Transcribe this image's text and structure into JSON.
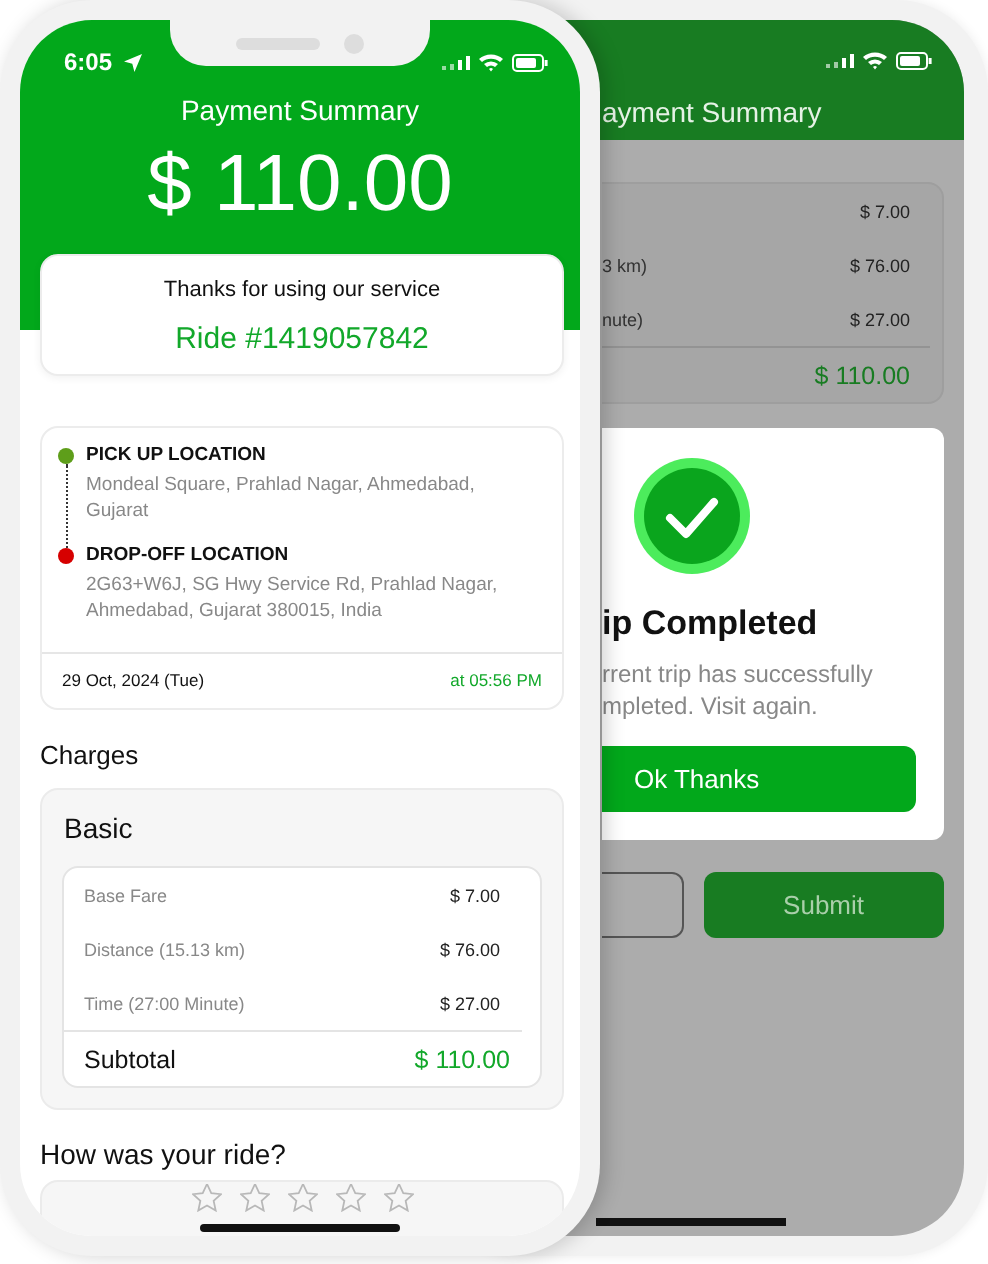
{
  "main_phone": {
    "status_bar": {
      "time": "6:05"
    },
    "header": {
      "title": "Payment Summary",
      "amount": "$ 110.00"
    },
    "ride_card": {
      "message": "Thanks for using our service",
      "ride_number": "Ride #1419057842"
    },
    "trip": {
      "stops": [
        {
          "kind": "pickup",
          "color": "#5e9e1a",
          "label": "PICK UP LOCATION",
          "address": "Mondeal Square, Prahlad Nagar, Ahmedabad, Gujarat"
        },
        {
          "kind": "dropoff",
          "color": "#d60000",
          "label": "DROP-OFF LOCATION",
          "address": "2G63+W6J, SG Hwy Service Rd, Prahlad Nagar, Ahmedabad, Gujarat 380015, India"
        }
      ],
      "date": "29 Oct, 2024 (Tue)",
      "time": "at 05:56 PM"
    },
    "charges": {
      "title": "Charges",
      "plan": "Basic",
      "rows": [
        {
          "label": "Base Fare",
          "amount": "$ 7.00"
        },
        {
          "label": "Distance (15.13 km)",
          "amount": "$ 76.00"
        },
        {
          "label": "Time (27:00 Minute)",
          "amount": "$ 27.00"
        }
      ],
      "subtotal_label": "Subtotal",
      "subtotal": "$ 110.00"
    },
    "rating": {
      "question": "How was your ride?",
      "stars": 0
    }
  },
  "second_phone": {
    "header_title": "ayment Summary",
    "charges": {
      "rows": [
        {
          "amount": "$ 7.00"
        },
        {
          "label": "3 km)",
          "amount": "$ 76.00"
        },
        {
          "label": "nute)",
          "amount": "$ 27.00"
        }
      ],
      "subtotal": "$ 110.00"
    },
    "dialog": {
      "title": "ip Completed",
      "message_lines": [
        "rrent trip has successfully",
        "mpleted. Visit again."
      ],
      "button": "Ok Thanks"
    },
    "buttons": [
      {
        "kind": "outline"
      },
      {
        "kind": "primary",
        "label": "Submit"
      }
    ]
  }
}
